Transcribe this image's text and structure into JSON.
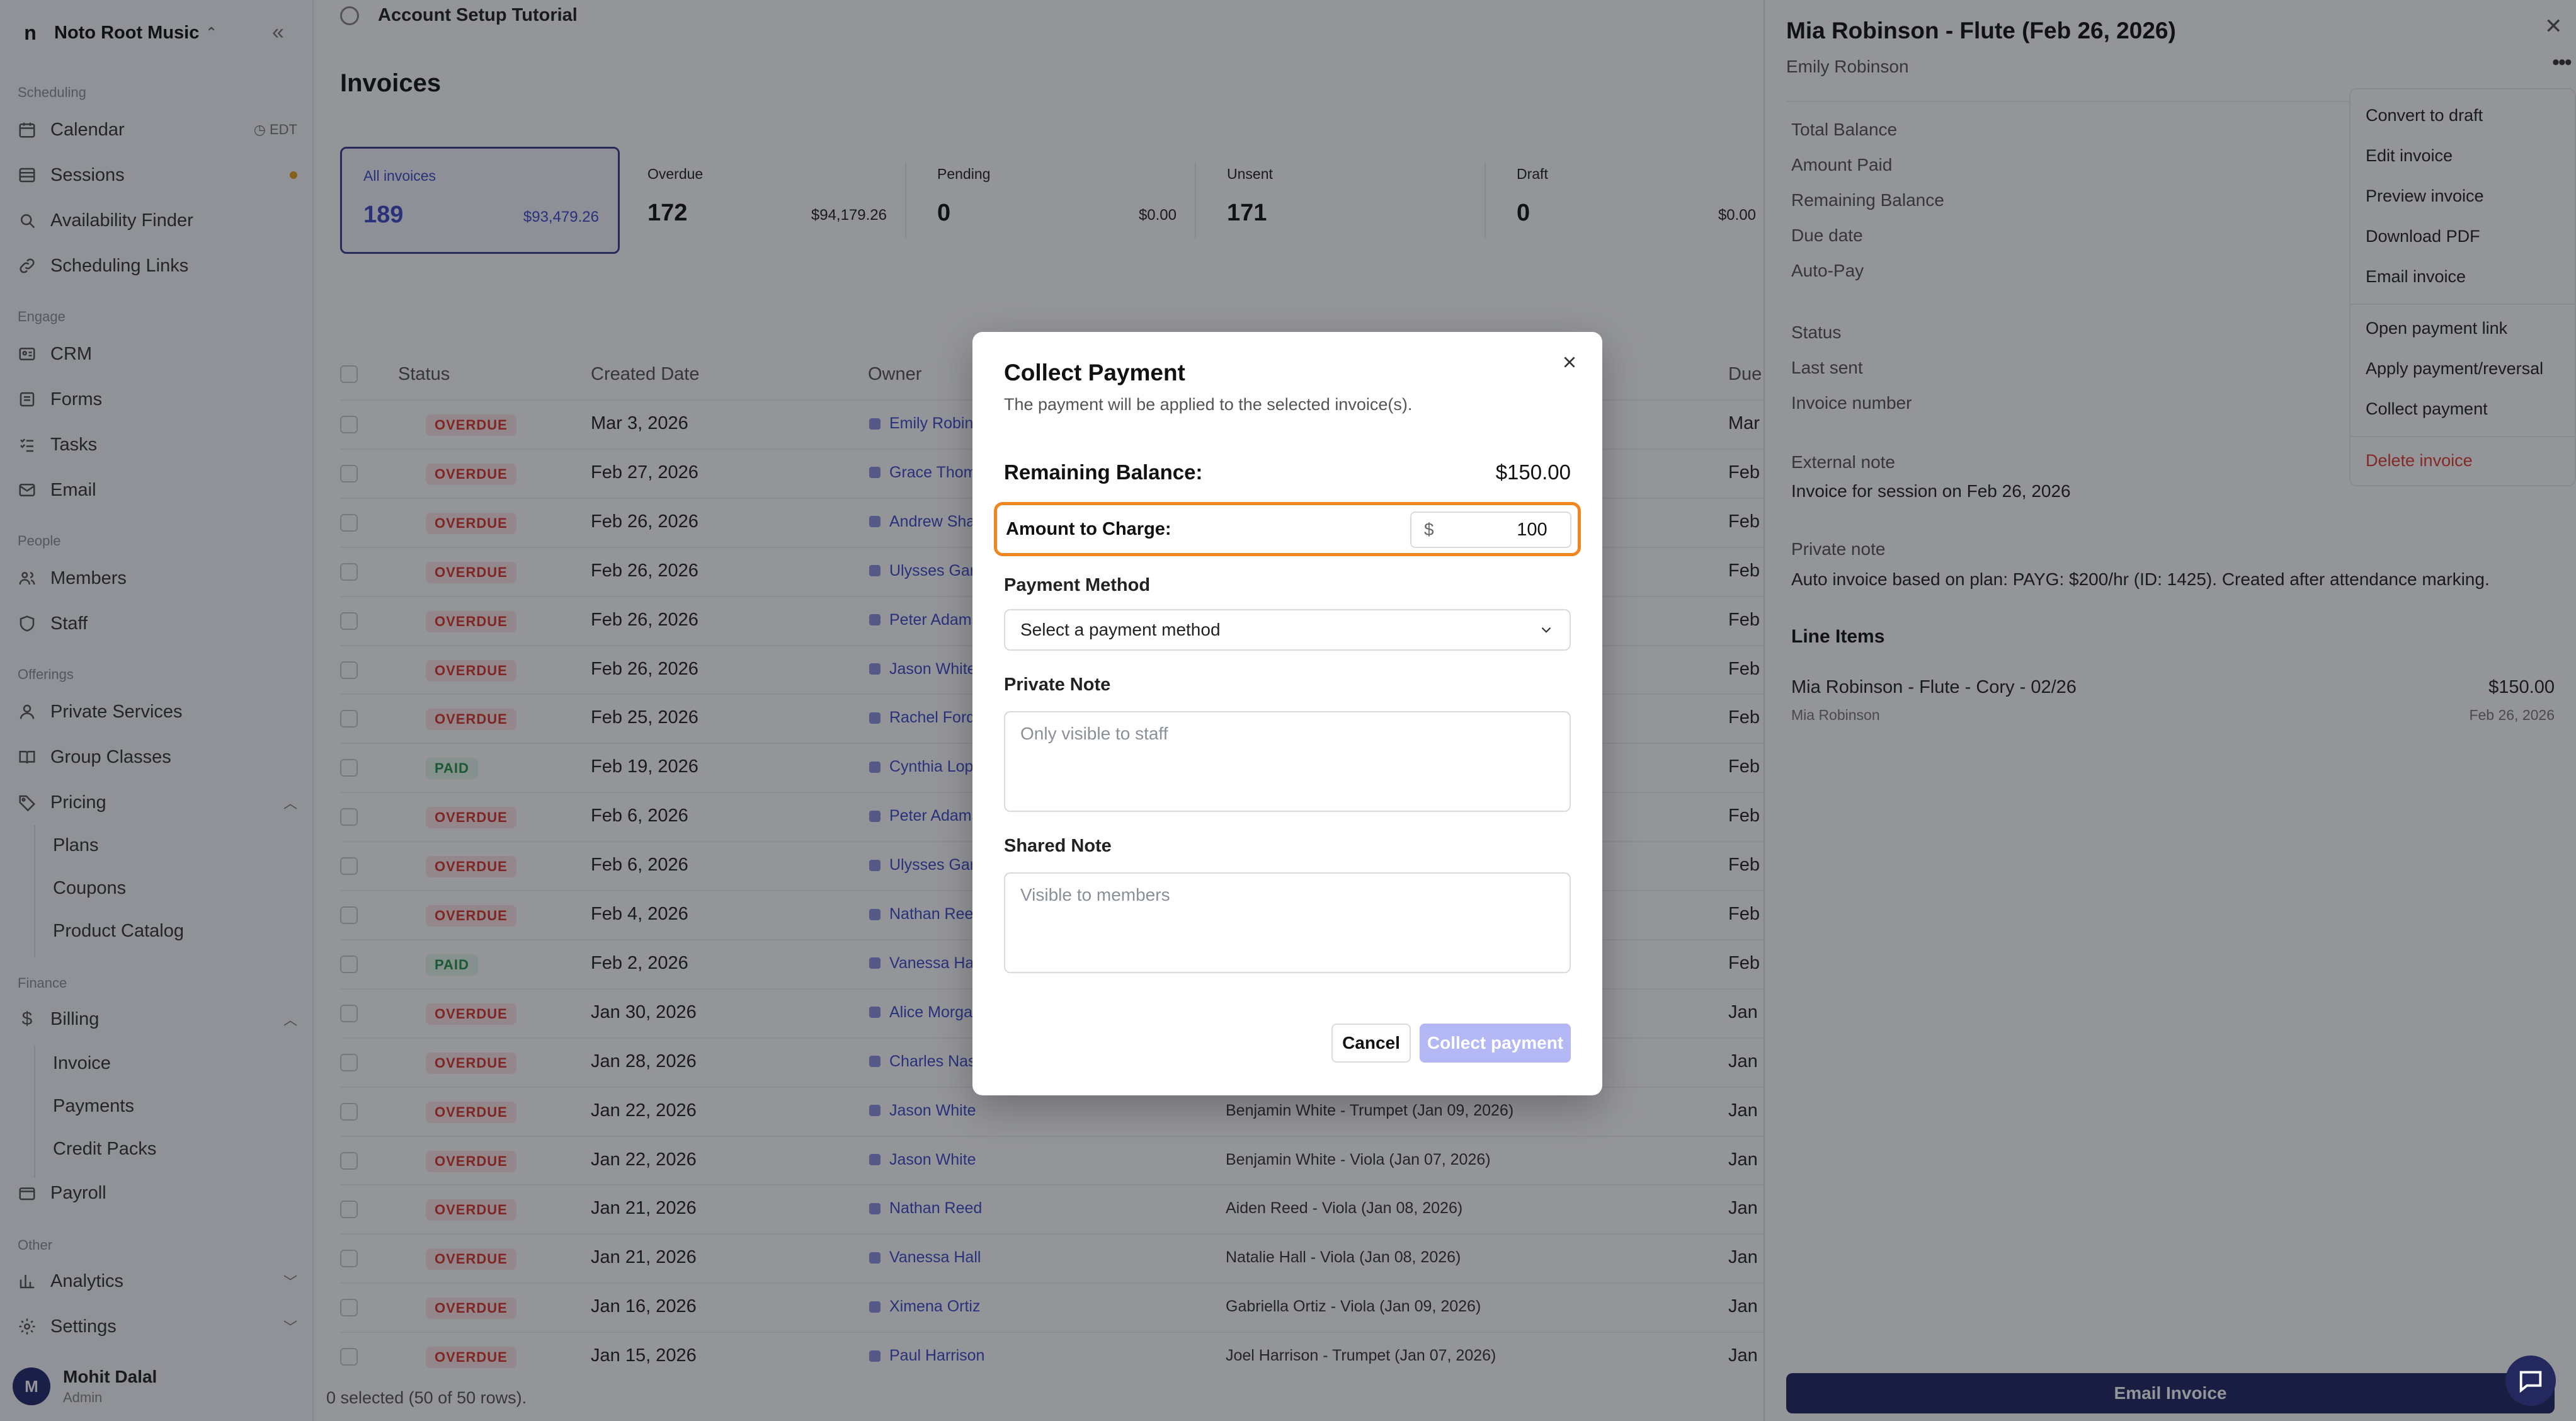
{
  "sidebar": {
    "org_name": "Noto Root Music",
    "logo": "n",
    "groups": {
      "scheduling": "Scheduling",
      "engage": "Engage",
      "people": "People",
      "offerings": "Offerings",
      "finance": "Finance",
      "other": "Other"
    },
    "items": {
      "calendar": "Calendar",
      "calendar_tag": "EDT",
      "sessions": "Sessions",
      "availability": "Availability Finder",
      "links": "Scheduling Links",
      "crm": "CRM",
      "forms": "Forms",
      "tasks": "Tasks",
      "email": "Email",
      "members": "Members",
      "staff": "Staff",
      "private_services": "Private Services",
      "group_classes": "Group Classes",
      "pricing": "Pricing",
      "plans": "Plans",
      "coupons": "Coupons",
      "product_catalog": "Product Catalog",
      "billing": "Billing",
      "invoice": "Invoice",
      "payments": "Payments",
      "credit_packs": "Credit Packs",
      "payroll": "Payroll",
      "analytics": "Analytics",
      "settings": "Settings"
    },
    "user": {
      "initial": "M",
      "name": "Mohit Dalal",
      "role": "Admin"
    }
  },
  "main": {
    "tutorial": "Account Setup Tutorial",
    "title": "Invoices",
    "cards": [
      {
        "label": "All invoices",
        "count": "189",
        "amount": "$93,479.26"
      },
      {
        "label": "Overdue",
        "count": "172",
        "amount": "$94,179.26"
      },
      {
        "label": "Pending",
        "count": "0",
        "amount": "$0.00"
      },
      {
        "label": "Unsent",
        "count": "171",
        "amount": ""
      },
      {
        "label": "Draft",
        "count": "0",
        "amount": "$0.00"
      }
    ],
    "columns": {
      "status": "Status",
      "created": "Created Date",
      "owner": "Owner",
      "due": "Due"
    },
    "rows": [
      {
        "status": "OVERDUE",
        "date": "Mar 3, 2026",
        "owner": "Emily Robinson",
        "desc": "",
        "due": "Mar"
      },
      {
        "status": "OVERDUE",
        "date": "Feb 27, 2026",
        "owner": "Grace Thompson",
        "desc": "",
        "due": "Feb"
      },
      {
        "status": "OVERDUE",
        "date": "Feb 26, 2026",
        "owner": "Andrew Sharma",
        "desc": "",
        "due": "Feb"
      },
      {
        "status": "OVERDUE",
        "date": "Feb 26, 2026",
        "owner": "Ulysses Garcia",
        "desc": "",
        "due": "Feb"
      },
      {
        "status": "OVERDUE",
        "date": "Feb 26, 2026",
        "owner": "Peter Adams",
        "desc": "",
        "due": "Feb"
      },
      {
        "status": "OVERDUE",
        "date": "Feb 26, 2026",
        "owner": "Jason White",
        "desc": "",
        "due": "Feb"
      },
      {
        "status": "OVERDUE",
        "date": "Feb 25, 2026",
        "owner": "Rachel Ford",
        "desc": "",
        "due": "Feb"
      },
      {
        "status": "PAID",
        "date": "Feb 19, 2026",
        "owner": "Cynthia Lopez",
        "desc": "",
        "due": "Feb"
      },
      {
        "status": "OVERDUE",
        "date": "Feb 6, 2026",
        "owner": "Peter Adams",
        "desc": "",
        "due": "Feb"
      },
      {
        "status": "OVERDUE",
        "date": "Feb 6, 2026",
        "owner": "Ulysses Garcia",
        "desc": "",
        "due": "Feb"
      },
      {
        "status": "OVERDUE",
        "date": "Feb 4, 2026",
        "owner": "Nathan Reed",
        "desc": "",
        "due": "Feb"
      },
      {
        "status": "PAID",
        "date": "Feb 2, 2026",
        "owner": "Vanessa Hall",
        "desc": "",
        "due": "Feb"
      },
      {
        "status": "OVERDUE",
        "date": "Jan 30, 2026",
        "owner": "Alice Morgan",
        "desc": "",
        "due": "Jan"
      },
      {
        "status": "OVERDUE",
        "date": "Jan 28, 2026",
        "owner": "Charles Nash",
        "desc": "",
        "due": "Jan"
      },
      {
        "status": "OVERDUE",
        "date": "Jan 22, 2026",
        "owner": "Jason White",
        "desc": "Benjamin White - Trumpet (Jan 09, 2026)",
        "due": "Jan"
      },
      {
        "status": "OVERDUE",
        "date": "Jan 22, 2026",
        "owner": "Jason White",
        "desc": "Benjamin White - Viola (Jan 07, 2026)",
        "due": "Jan"
      },
      {
        "status": "OVERDUE",
        "date": "Jan 21, 2026",
        "owner": "Nathan Reed",
        "desc": "Aiden Reed - Viola (Jan 08, 2026)",
        "due": "Jan"
      },
      {
        "status": "OVERDUE",
        "date": "Jan 21, 2026",
        "owner": "Vanessa Hall",
        "desc": "Natalie Hall - Viola (Jan 08, 2026)",
        "due": "Jan"
      },
      {
        "status": "OVERDUE",
        "date": "Jan 16, 2026",
        "owner": "Ximena Ortiz",
        "desc": "Gabriella Ortiz - Viola (Jan 09, 2026)",
        "due": "Jan"
      },
      {
        "status": "OVERDUE",
        "date": "Jan 15, 2026",
        "owner": "Paul Harrison",
        "desc": "Joel Harrison - Trumpet (Jan 07, 2026)",
        "due": "Jan"
      }
    ],
    "footer": "0 selected (50 of 50 rows)."
  },
  "drawer": {
    "title": "Mia Robinson - Flute (Feb 26, 2026)",
    "subtitle": "Emily Robinson",
    "fields": {
      "total": "Total Balance",
      "paid": "Amount Paid",
      "remaining": "Remaining Balance",
      "due": "Due date",
      "autopay": "Auto-Pay",
      "status": "Status",
      "last_sent": "Last sent",
      "number": "Invoice number"
    },
    "external_note_label": "External note",
    "external_note": "Invoice for session on Feb 26, 2026",
    "private_note_label": "Private note",
    "private_note": "Auto invoice based on plan: PAYG: $200/hr (ID: 1425). Created after attendance marking.",
    "line_items_label": "Line Items",
    "line_item": {
      "name": "Mia Robinson - Flute - Cory - 02/26",
      "sub": "Mia Robinson",
      "amount": "$150.00",
      "date": "Feb 26, 2026"
    },
    "email_button": "Email Invoice"
  },
  "menu": {
    "items": [
      "Convert to draft",
      "Edit invoice",
      "Preview invoice",
      "Download PDF",
      "Email invoice",
      "Open payment link",
      "Apply payment/reversal",
      "Collect payment"
    ],
    "delete": "Delete invoice"
  },
  "modal": {
    "title": "Collect Payment",
    "subtitle": "The payment will be applied to the selected invoice(s).",
    "remaining_label": "Remaining Balance:",
    "remaining_value": "$150.00",
    "amount_label": "Amount to Charge:",
    "currency": "$",
    "amount_value": "100",
    "payment_method_label": "Payment Method",
    "payment_method_placeholder": "Select a payment method",
    "private_note_label": "Private Note",
    "private_note_placeholder": "Only visible to staff",
    "shared_note_label": "Shared Note",
    "shared_note_placeholder": "Visible to members",
    "cancel": "Cancel",
    "collect": "Collect payment"
  },
  "colors": {
    "accent": "#3f4ac8",
    "highlight": "#f0861d",
    "overdue": "#d9352c",
    "paid": "#23904a",
    "primary_dark": "#1e2560",
    "collect_disabled": "#b4b8f4"
  }
}
